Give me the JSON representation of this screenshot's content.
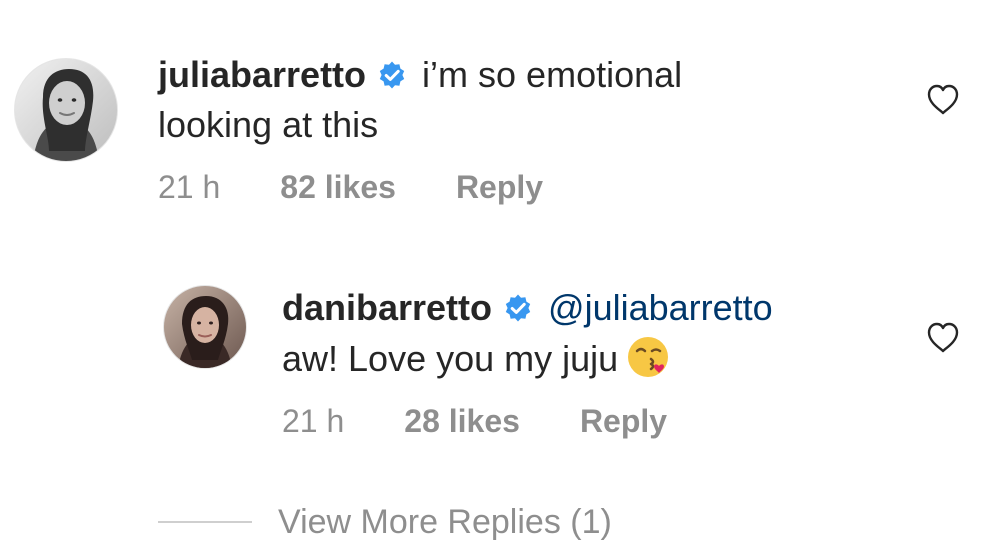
{
  "comments": [
    {
      "username": "juliabarretto",
      "text_line1": "i’m so emotional",
      "text_line2": "looking at this",
      "time": "21 h",
      "likes": "82 likes",
      "reply_label": "Reply",
      "verified": true
    },
    {
      "username": "danibarretto",
      "mention": "@juliabarretto",
      "text_line2": "aw! Love you my juju",
      "emoji": "😘",
      "time": "21 h",
      "likes": "28 likes",
      "reply_label": "Reply",
      "verified": true
    }
  ],
  "view_more_replies": "View More Replies (1)",
  "colors": {
    "text": "#262626",
    "meta": "#8e8e8e",
    "mention": "#00376b",
    "verified_blue": "#3897f0"
  }
}
